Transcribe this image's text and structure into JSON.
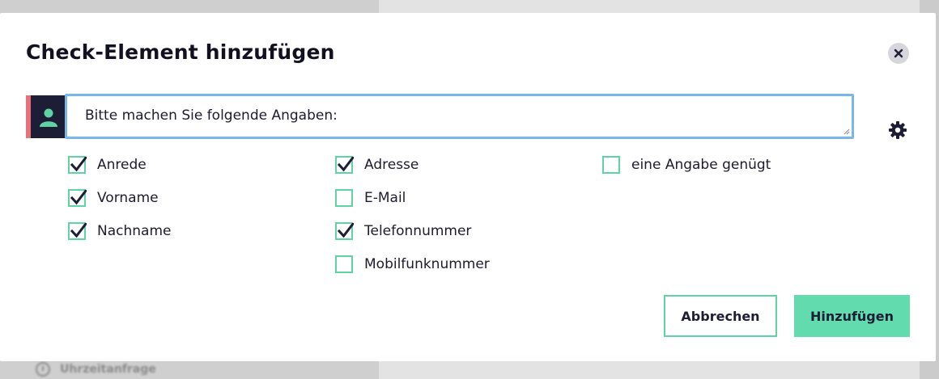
{
  "background": {
    "item_label": "Uhrzeitanfrage",
    "item_icon": "clock-icon"
  },
  "modal": {
    "title": "Check-Element hinzufügen",
    "close_icon": "close-icon",
    "prompt": {
      "avatar_icon": "person-icon",
      "value": "Bitte machen Sie folgende Angaben:",
      "settings_icon": "gear-icon"
    },
    "options": {
      "column1": [
        {
          "label": "Anrede",
          "checked": true
        },
        {
          "label": "Vorname",
          "checked": true
        },
        {
          "label": "Nachname",
          "checked": true
        }
      ],
      "column2": [
        {
          "label": "Adresse",
          "checked": true
        },
        {
          "label": "E-Mail",
          "checked": false
        },
        {
          "label": "Telefonnummer",
          "checked": true
        },
        {
          "label": "Mobilfunknummer",
          "checked": false
        }
      ],
      "column3": [
        {
          "label": "eine Angabe genügt",
          "checked": false
        }
      ]
    },
    "buttons": {
      "cancel": "Abbrechen",
      "add": "Hinzufügen"
    }
  },
  "colors": {
    "accent": "#62dcae",
    "checkbox_border": "#5fd3a4",
    "focus_border": "#77b8ea",
    "avatar_bg": "#1d1d35",
    "avatar_accent": "#e8707a"
  }
}
